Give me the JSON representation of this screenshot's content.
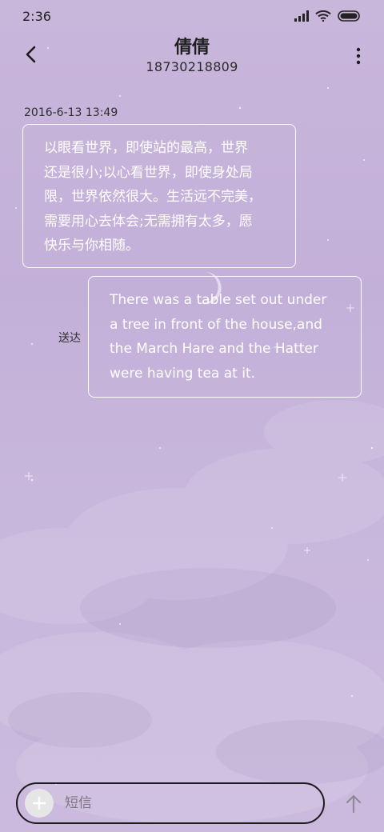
{
  "status_bar": {
    "time": "2:36",
    "icons": [
      "signal-icon",
      "wifi-icon",
      "battery-icon"
    ]
  },
  "header": {
    "contact_name": "倩倩",
    "phone_number": "18730218809",
    "icons": [
      "back-arrow-icon",
      "more-vertical-icon"
    ]
  },
  "conversation": {
    "timestamp": "2016-6-13 13:49",
    "messages": [
      {
        "direction": "incoming",
        "lines": [
          "以眼看世界，即使站的最高，世界",
          "还是很小;以心看世界，即使身处局",
          "限，世界依然很大。生活远不完美，",
          "需要用心去体会;无需拥有太多，愿",
          "快乐与你相随。"
        ]
      },
      {
        "direction": "outgoing",
        "status": "送达",
        "lines": [
          "There was a table set out under",
          "a tree in front of the house,and",
          "the March Hare and the Hatter",
          "were having tea at it."
        ]
      }
    ]
  },
  "composer": {
    "placeholder": "短信",
    "icons": [
      "add-icon",
      "send-arrow-icon"
    ]
  },
  "colors": {
    "background": "#c5b3da",
    "bubble_border": "#ffffff",
    "bubble_text": "#ffffff"
  }
}
